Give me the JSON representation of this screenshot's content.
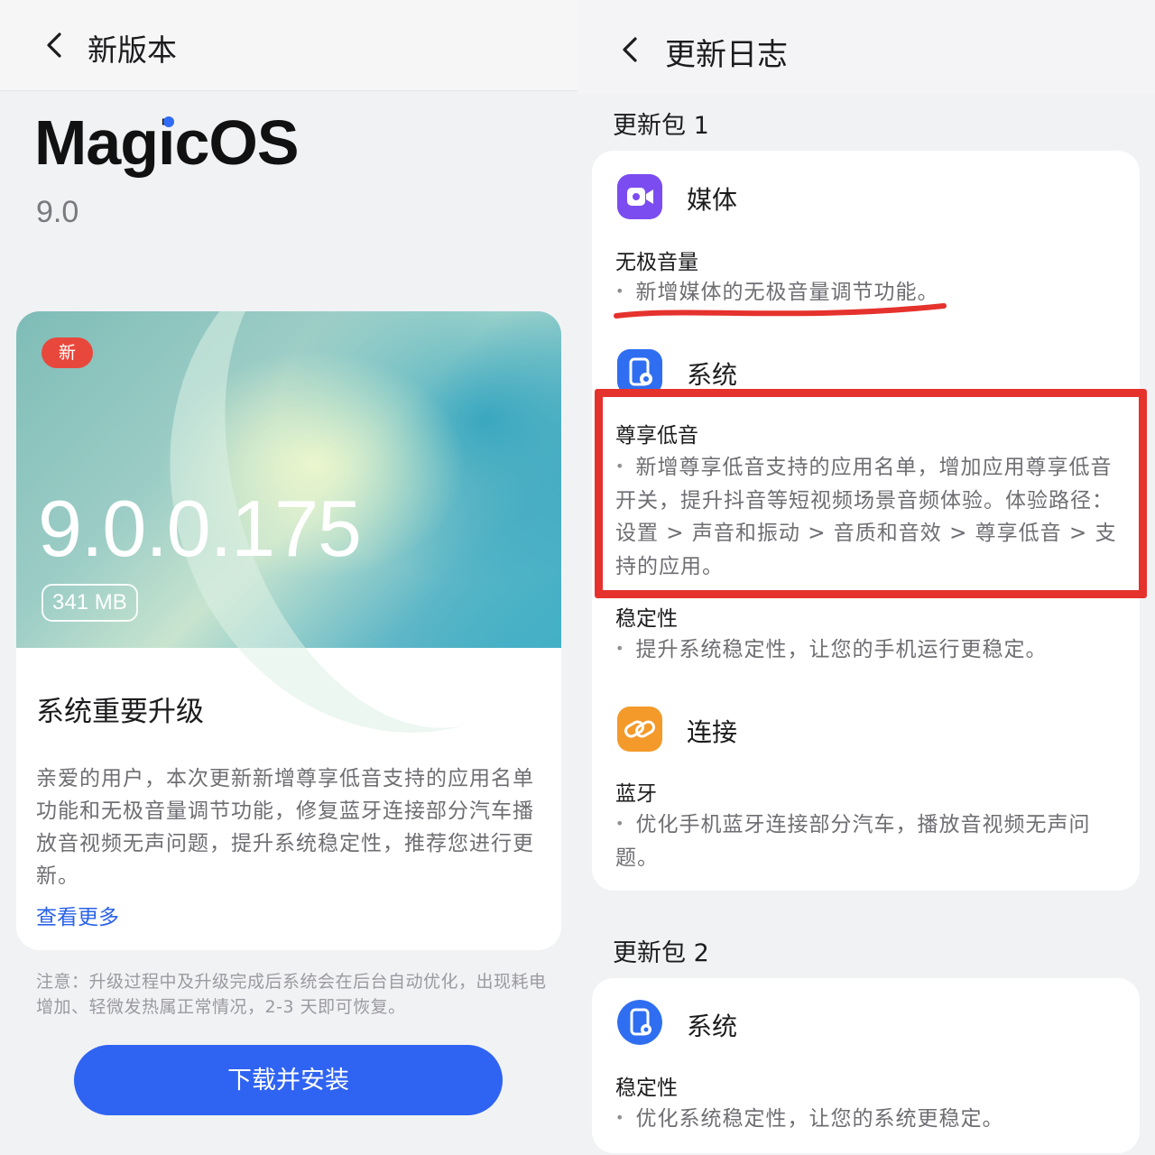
{
  "left": {
    "header": {
      "back_icon": "chevron-left-icon",
      "title": "新版本"
    },
    "os": {
      "name": "MagicOS",
      "version": "9.0"
    },
    "card": {
      "badge": "新",
      "build": "9.0.0.175",
      "size": "341 MB",
      "heading": "系统重要升级",
      "description": "亲爱的用户，本次更新新增尊享低音支持的应用名单功能和无极音量调节功能，修复蓝牙连接部分汽车播放音视频无声问题，提升系统稳定性，推荐您进行更新。",
      "more_link": "查看更多"
    },
    "note": "注意：升级过程中及升级完成后系统会在后台自动优化，出现耗电增加、轻微发热属正常情况，2-3 天即可恢复。",
    "download_button": "下载并安装"
  },
  "right": {
    "header": {
      "back_icon": "chevron-left-icon",
      "title": "更新日志"
    },
    "package1": {
      "label": "更新包 1",
      "media": {
        "icon": "video-camera-icon",
        "title": "媒体",
        "item_title": "无极音量",
        "item_desc": "新增媒体的无极音量调节功能。"
      },
      "system": {
        "icon": "system-settings-icon",
        "title": "系统",
        "bass_title": "尊享低音",
        "bass_desc": "新增尊享低音支持的应用名单，增加应用尊享低音开关，提升抖音等短视频场景音频体验。体验路径：设置 > 声音和振动 > 音质和音效 > 尊享低音 > 支持的应用。",
        "stability_title": "稳定性",
        "stability_desc": "提升系统稳定性，让您的手机运行更稳定。"
      },
      "connect": {
        "icon": "link-icon",
        "title": "连接",
        "item_title": "蓝牙",
        "item_desc": "优化手机蓝牙连接部分汽车，播放音视频无声问题。"
      }
    },
    "package2": {
      "label": "更新包 2",
      "system": {
        "icon": "system-settings-icon",
        "title": "系统",
        "item_title": "稳定性",
        "item_desc": "优化系统稳定性，让您的系统更稳定。"
      }
    }
  },
  "colors": {
    "accent_blue": "#2f63f2",
    "badge_red": "#e8483c",
    "annotation_red": "#e5322d",
    "media_purple": "#7b4cf0",
    "system_blue": "#2f6ef0",
    "connect_orange": "#f39a2b"
  }
}
